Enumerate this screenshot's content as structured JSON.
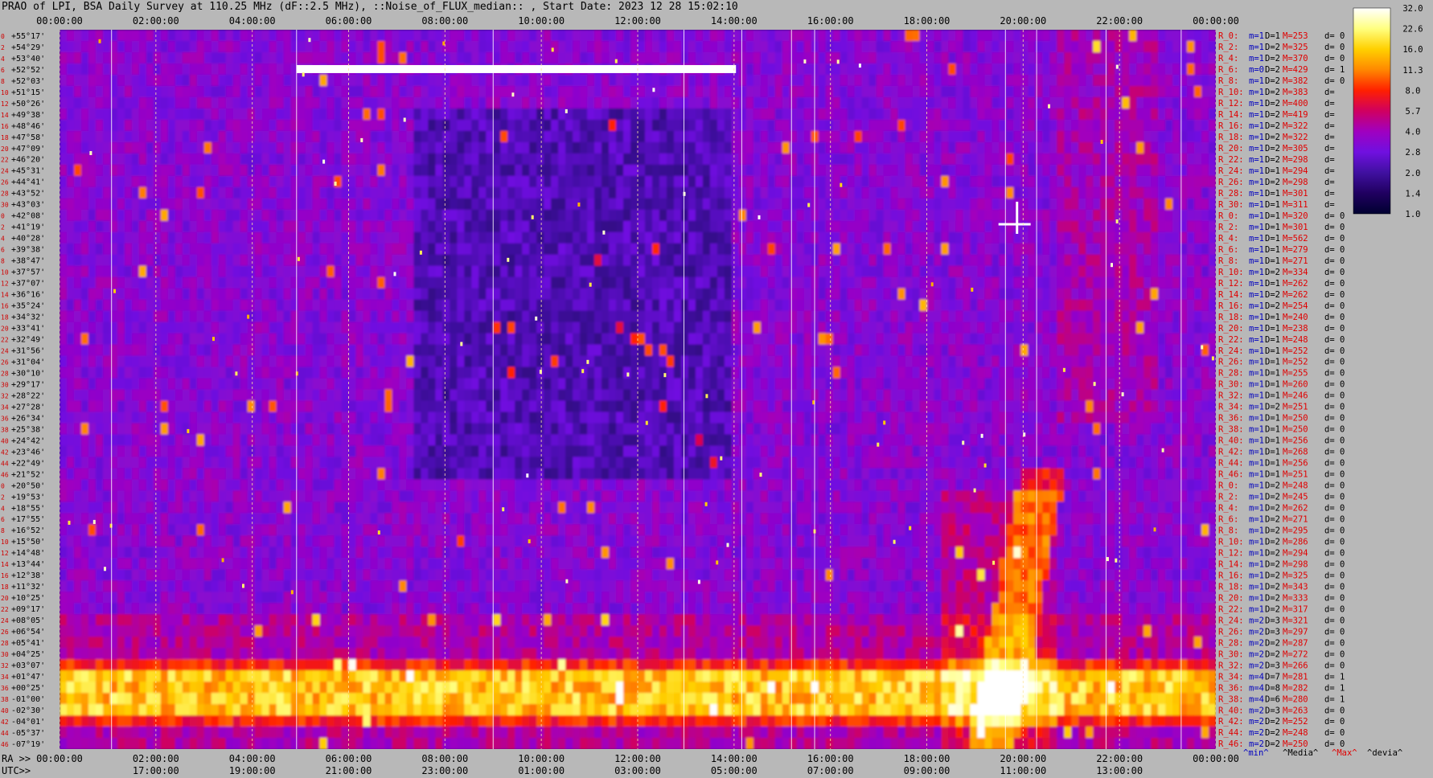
{
  "title": "PRAO of LPI, BSA Daily Survey at 110.25 MHz (dF::2.5 MHz), ::Noise_of_FLUX_median:: , Start Date: 2023 12 28 15:02:10",
  "chart_data": {
    "type": "heatmap",
    "x_top_ticks": [
      "00:00:00",
      "02:00:00",
      "04:00:00",
      "06:00:00",
      "08:00:00",
      "10:00:00",
      "12:00:00",
      "14:00:00",
      "16:00:00",
      "18:00:00",
      "20:00:00",
      "22:00:00",
      "00:00:00"
    ],
    "x_bottom_ra_label": "RA >>",
    "x_bottom_ra_ticks": [
      "00:00:00",
      "02:00:00",
      "04:00:00",
      "06:00:00",
      "08:00:00",
      "10:00:00",
      "12:00:00",
      "14:00:00",
      "16:00:00",
      "18:00:00",
      "20:00:00",
      "22:00:00",
      "00:00:00"
    ],
    "x_bottom_utc_label": "UTC>>",
    "x_bottom_utc_ticks": [
      "17:00:00",
      "19:00:00",
      "21:00:00",
      "23:00:00",
      "01:00:00",
      "03:00:00",
      "05:00:00",
      "07:00:00",
      "09:00:00",
      "11:00:00",
      "13:00:00"
    ],
    "y_ticks": [
      "+55°17'",
      "+54°29'",
      "+53°40'",
      "+52°52'",
      "+52°03'",
      "+51°15'",
      "+50°26'",
      "+49°38'",
      "+48°46'",
      "+47°58'",
      "+47°09'",
      "+46°20'",
      "+45°31'",
      "+44°41'",
      "+43°52'",
      "+43°03'",
      "+42°08'",
      "+41°19'",
      "+40°28'",
      "+39°38'",
      "+38°47'",
      "+37°57'",
      "+37°07'",
      "+36°16'",
      "+35°24'",
      "+34°32'",
      "+33°41'",
      "+32°49'",
      "+31°56'",
      "+31°04'",
      "+30°10'",
      "+29°17'",
      "+28°22'",
      "+27°28'",
      "+26°34'",
      "+25°38'",
      "+24°42'",
      "+23°46'",
      "+22°49'",
      "+21°52'",
      "+20°50'",
      "+19°53'",
      "+18°55'",
      "+17°55'",
      "+16°52'",
      "+15°50'",
      "+14°48'",
      "+13°44'",
      "+12°38'",
      "+11°32'",
      "+10°25'",
      "+09°17'",
      "+08°05'",
      "+06°54'",
      "+05°41'",
      "+04°25'",
      "+03°07'",
      "+01°47'",
      "+00°25'",
      "-01°00'",
      "-02°30'",
      "-04°01'",
      "-05°37'",
      "-07°19'"
    ],
    "row_index_labels": [
      "0",
      "2",
      "4",
      "6",
      "8",
      "10",
      "12",
      "14",
      "16",
      "18",
      "20",
      "22",
      "24",
      "26",
      "28",
      "30",
      "0",
      "2",
      "4",
      "6",
      "8",
      "10",
      "12",
      "14",
      "16",
      "18",
      "20",
      "22",
      "24",
      "26",
      "28",
      "30",
      "32",
      "34",
      "36",
      "38",
      "40",
      "42",
      "44",
      "46",
      "0",
      "2",
      "4",
      "6",
      "8",
      "10",
      "12",
      "14",
      "16",
      "18",
      "20",
      "22",
      "24",
      "26",
      "28",
      "30",
      "32",
      "34",
      "36",
      "38",
      "40",
      "42",
      "44",
      "46"
    ],
    "colorbar": {
      "ticks": [
        "32.0",
        "22.6",
        "16.0",
        "11.3",
        "8.0",
        "5.7",
        "4.0",
        "2.8",
        "2.0",
        "1.4",
        "1.0"
      ],
      "scale": "log",
      "range": [
        1.0,
        32.0
      ],
      "colors": [
        "#ffffff",
        "#ffff80",
        "#ffd000",
        "#ff8800",
        "#ff2000",
        "#d00060",
        "#a000c0",
        "#7010e0",
        "#4010a0",
        "#200060",
        "#000030"
      ]
    },
    "beam_stats": [
      [
        "R_0:",
        "m=1",
        "D=1",
        "M=253",
        "d= 0"
      ],
      [
        "R_2:",
        "m=1",
        "D=2",
        "M=325",
        "d= 0"
      ],
      [
        "R_4:",
        "m=1",
        "D=2",
        "M=370",
        "d= 0"
      ],
      [
        "R_6:",
        "m=0",
        "D=2",
        "M=429",
        "d= 1"
      ],
      [
        "R_8:",
        "m=1",
        "D=2",
        "M=382",
        "d= 0"
      ],
      [
        "R_10:",
        "m=1",
        "D=2",
        "M=383",
        "d="
      ],
      [
        "R_12:",
        "m=1",
        "D=2",
        "M=400",
        "d="
      ],
      [
        "R_14:",
        "m=1",
        "D=2",
        "M=419",
        "d="
      ],
      [
        "R_16:",
        "m=1",
        "D=2",
        "M=322",
        "d="
      ],
      [
        "R_18:",
        "m=1",
        "D=2",
        "M=322",
        "d="
      ],
      [
        "R_20:",
        "m=1",
        "D=2",
        "M=305",
        "d="
      ],
      [
        "R_22:",
        "m=1",
        "D=2",
        "M=298",
        "d="
      ],
      [
        "R_24:",
        "m=1",
        "D=1",
        "M=294",
        "d="
      ],
      [
        "R_26:",
        "m=1",
        "D=2",
        "M=298",
        "d="
      ],
      [
        "R_28:",
        "m=1",
        "D=1",
        "M=301",
        "d="
      ],
      [
        "R_30:",
        "m=1",
        "D=1",
        "M=311",
        "d="
      ],
      [
        "R_0:",
        "m=1",
        "D=1",
        "M=320",
        "d= 0"
      ],
      [
        "R_2:",
        "m=1",
        "D=1",
        "M=301",
        "d= 0"
      ],
      [
        "R_4:",
        "m=1",
        "D=1",
        "M=562",
        "d= 0"
      ],
      [
        "R_6:",
        "m=1",
        "D=1",
        "M=279",
        "d= 0"
      ],
      [
        "R_8:",
        "m=1",
        "D=1",
        "M=271",
        "d= 0"
      ],
      [
        "R_10:",
        "m=1",
        "D=2",
        "M=334",
        "d= 0"
      ],
      [
        "R_12:",
        "m=1",
        "D=1",
        "M=262",
        "d= 0"
      ],
      [
        "R_14:",
        "m=1",
        "D=2",
        "M=262",
        "d= 0"
      ],
      [
        "R_16:",
        "m=1",
        "D=2",
        "M=254",
        "d= 0"
      ],
      [
        "R_18:",
        "m=1",
        "D=1",
        "M=240",
        "d= 0"
      ],
      [
        "R_20:",
        "m=1",
        "D=1",
        "M=238",
        "d= 0"
      ],
      [
        "R_22:",
        "m=1",
        "D=1",
        "M=248",
        "d= 0"
      ],
      [
        "R_24:",
        "m=1",
        "D=1",
        "M=252",
        "d= 0"
      ],
      [
        "R_26:",
        "m=1",
        "D=1",
        "M=252",
        "d= 0"
      ],
      [
        "R_28:",
        "m=1",
        "D=1",
        "M=255",
        "d= 0"
      ],
      [
        "R_30:",
        "m=1",
        "D=1",
        "M=260",
        "d= 0"
      ],
      [
        "R_32:",
        "m=1",
        "D=1",
        "M=246",
        "d= 0"
      ],
      [
        "R_34:",
        "m=1",
        "D=2",
        "M=251",
        "d= 0"
      ],
      [
        "R_36:",
        "m=1",
        "D=1",
        "M=250",
        "d= 0"
      ],
      [
        "R_38:",
        "m=1",
        "D=1",
        "M=250",
        "d= 0"
      ],
      [
        "R_40:",
        "m=1",
        "D=1",
        "M=256",
        "d= 0"
      ],
      [
        "R_42:",
        "m=1",
        "D=1",
        "M=268",
        "d= 0"
      ],
      [
        "R_44:",
        "m=1",
        "D=1",
        "M=256",
        "d= 0"
      ],
      [
        "R_46:",
        "m=1",
        "D=1",
        "M=251",
        "d= 0"
      ],
      [
        "R_0:",
        "m=1",
        "D=2",
        "M=248",
        "d= 0"
      ],
      [
        "R_2:",
        "m=1",
        "D=2",
        "M=245",
        "d= 0"
      ],
      [
        "R_4:",
        "m=1",
        "D=2",
        "M=262",
        "d= 0"
      ],
      [
        "R_6:",
        "m=1",
        "D=2",
        "M=271",
        "d= 0"
      ],
      [
        "R_8:",
        "m=1",
        "D=2",
        "M=295",
        "d= 0"
      ],
      [
        "R_10:",
        "m=1",
        "D=2",
        "M=286",
        "d= 0"
      ],
      [
        "R_12:",
        "m=1",
        "D=2",
        "M=294",
        "d= 0"
      ],
      [
        "R_14:",
        "m=1",
        "D=2",
        "M=298",
        "d= 0"
      ],
      [
        "R_16:",
        "m=1",
        "D=2",
        "M=325",
        "d= 0"
      ],
      [
        "R_18:",
        "m=1",
        "D=2",
        "M=343",
        "d= 0"
      ],
      [
        "R_20:",
        "m=1",
        "D=2",
        "M=333",
        "d= 0"
      ],
      [
        "R_22:",
        "m=1",
        "D=2",
        "M=317",
        "d= 0"
      ],
      [
        "R_24:",
        "m=2",
        "D=3",
        "M=321",
        "d= 0"
      ],
      [
        "R_26:",
        "m=2",
        "D=3",
        "M=297",
        "d= 0"
      ],
      [
        "R_28:",
        "m=2",
        "D=2",
        "M=287",
        "d= 0"
      ],
      [
        "R_30:",
        "m=2",
        "D=2",
        "M=272",
        "d= 0"
      ],
      [
        "R_32:",
        "m=2",
        "D=3",
        "M=266",
        "d= 0"
      ],
      [
        "R_34:",
        "m=4",
        "D=7",
        "M=281",
        "d= 1"
      ],
      [
        "R_36:",
        "m=4",
        "D=8",
        "M=282",
        "d= 1"
      ],
      [
        "R_38:",
        "m=4",
        "D=6",
        "M=280",
        "d= 1"
      ],
      [
        "R_40:",
        "m=2",
        "D=3",
        "M=263",
        "d= 0"
      ],
      [
        "R_42:",
        "m=2",
        "D=2",
        "M=252",
        "d= 0"
      ],
      [
        "R_44:",
        "m=2",
        "D=2",
        "M=248",
        "d= 0"
      ],
      [
        "R_46:",
        "m=2",
        "D=2",
        "M=250",
        "d= 0"
      ]
    ],
    "stats_legend": [
      "^min^",
      "^Media^",
      "^Max^",
      "^devia^"
    ],
    "stats_legend_colors": [
      "#0000c0",
      "#000000",
      "#e00000",
      "#000000"
    ],
    "beam_stats_colors": {
      "label": "#e00000",
      "m": "#0000c0",
      "D": "#000000",
      "M": "#e00000",
      "d": "#000000"
    }
  }
}
